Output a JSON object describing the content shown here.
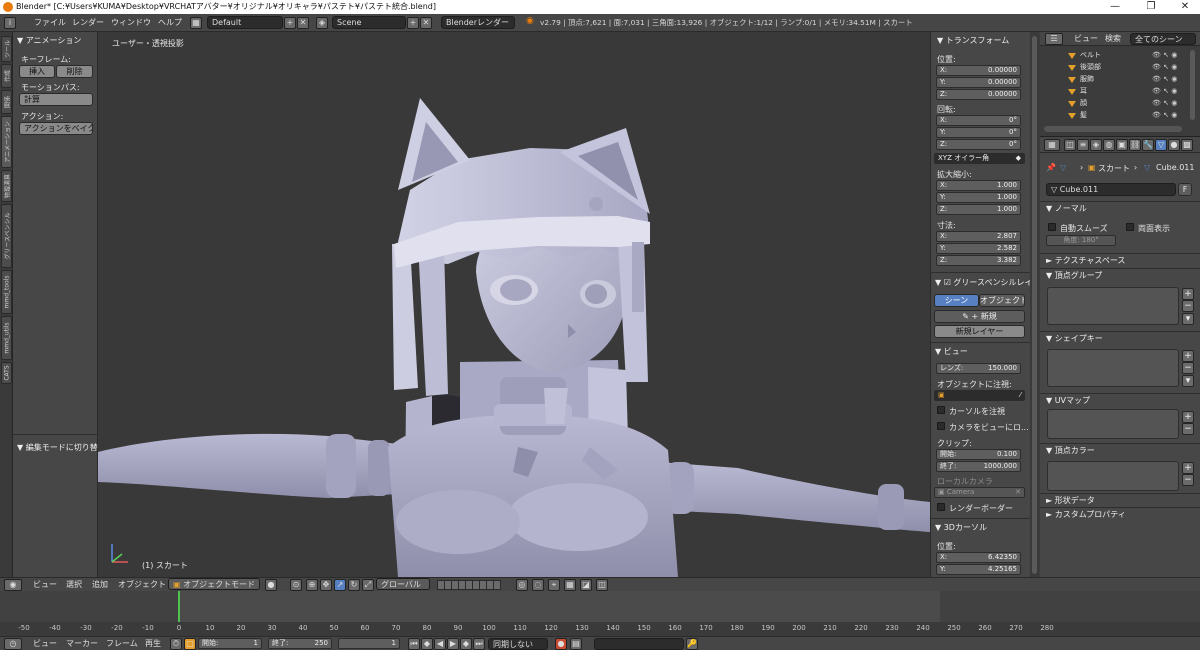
{
  "titlebar": {
    "text": "Blender* [C:¥Users¥KUMA¥Desktop¥VRCHATアバター¥オリジナル¥オリキャラ¥パステト¥パステト統合.blend]",
    "minimize": "—",
    "maximize": "❐",
    "close": "✕"
  },
  "topbar": {
    "menus": [
      "ファイル",
      "レンダー",
      "ウィンドウ",
      "ヘルプ"
    ],
    "screen_layout": "Default",
    "scene": "Scene",
    "render_engine": "Blenderレンダー",
    "stats": "v2.79 | 頂点:7,621 | 面:7,031 | 三角面:13,926 | オブジェクト:1/12 | ランプ:0/1 | メモリ:34.51M | スカート"
  },
  "tool_tabs": [
    "ツール",
    "作成",
    "関係",
    "アニメーション",
    "物理演算",
    "グリースペンシル",
    "mmd_tools",
    "mmd_utils",
    "CATS"
  ],
  "shelf": {
    "panel_title": "アニメーション",
    "keyframes_label": "キーフレーム:",
    "insert": "挿入",
    "delete": "削除",
    "motion_paths_label": "モーションパス:",
    "calculate": "計算",
    "action_label": "アクション:",
    "bake_action": "アクションをベイク",
    "operator_panel": "編集モードに切り替え"
  },
  "viewport": {
    "label": "ユーザー・透視投影",
    "object_label": "(1) スカート"
  },
  "npanel": {
    "transform_title": "トランスフォーム",
    "location_label": "位置:",
    "location": [
      {
        "axis": "X:",
        "value": "0.00000"
      },
      {
        "axis": "Y:",
        "value": "0.00000"
      },
      {
        "axis": "Z:",
        "value": "0.00000"
      }
    ],
    "rotation_label": "回転:",
    "rotation": [
      {
        "axis": "X:",
        "value": "0°"
      },
      {
        "axis": "Y:",
        "value": "0°"
      },
      {
        "axis": "Z:",
        "value": "0°"
      }
    ],
    "rotation_mode": "XYZ オイラー角",
    "scale_label": "拡大縮小:",
    "scale": [
      {
        "axis": "X:",
        "value": "1.000"
      },
      {
        "axis": "Y:",
        "value": "1.000"
      },
      {
        "axis": "Z:",
        "value": "1.000"
      }
    ],
    "dimensions_label": "寸法:",
    "dimensions": [
      {
        "axis": "X:",
        "value": "2.807"
      },
      {
        "axis": "Y:",
        "value": "2.582"
      },
      {
        "axis": "Z:",
        "value": "3.382"
      }
    ],
    "grease_title": "グリースペンシルレイ",
    "scene_btn": "シーン",
    "object_btn": "オブジェクト",
    "new_btn": "新規",
    "new_layer_btn": "新規レイヤー",
    "view_title": "ビュー",
    "lens_label": "レンズ:",
    "lens_value": "150.000",
    "lock_object_label": "オブジェクトに注視:",
    "lock_cursor": "カーソルを注視",
    "lock_camera": "カメラをビューにロ...",
    "clip_label": "クリップ:",
    "clip_start_label": "開始:",
    "clip_start": "0.100",
    "clip_end_label": "終了:",
    "clip_end": "1000.000",
    "local_camera_label": "ローカルカメラ",
    "camera": "Camera",
    "render_border": "レンダーボーダー",
    "cursor_title": "3Dカーソル",
    "cursor_location_label": "位置:",
    "cursor_x_label": "X:",
    "cursor_x": "6.42350",
    "cursor_y_label": "Y:",
    "cursor_y": "4.25165"
  },
  "outliner": {
    "view_menu": "ビュー",
    "search_menu": "検索",
    "scene_filter": "全てのシーン",
    "items": [
      "ベルト",
      "後頭部",
      "服飾",
      "耳",
      "顔",
      "髪"
    ]
  },
  "properties": {
    "breadcrumb_object": "スカート",
    "breadcrumb_data": "Cube.011",
    "mesh_name": "Cube.011",
    "fake_user": "F",
    "normals_title": "ノーマル",
    "auto_smooth": "自動スムーズ",
    "double_sided": "両面表示",
    "angle_label": "角度:",
    "angle_value": "180°",
    "texture_space": "テクスチャスペース",
    "vertex_groups": "頂点グループ",
    "shape_keys": "シェイプキー",
    "uv_maps": "UVマップ",
    "vertex_colors": "頂点カラー",
    "geometry_data": "形状データ",
    "custom_props": "カスタムプロパティ"
  },
  "viewport_header": {
    "menus": [
      "ビュー",
      "選択",
      "追加",
      "オブジェクト"
    ],
    "mode": "オブジェクトモード",
    "orientation": "グローバル"
  },
  "timeline": {
    "ticks": [
      "-50",
      "-40",
      "-30",
      "-20",
      "-10",
      "0",
      "10",
      "20",
      "30",
      "40",
      "50",
      "60",
      "70",
      "80",
      "90",
      "100",
      "110",
      "120",
      "130",
      "140",
      "150",
      "160",
      "170",
      "180",
      "190",
      "200",
      "210",
      "220",
      "230",
      "240",
      "250",
      "260",
      "270",
      "280"
    ],
    "menus": [
      "ビュー",
      "マーカー",
      "フレーム",
      "再生"
    ],
    "start_label": "開始:",
    "start": "1",
    "end_label": "終了:",
    "end": "250",
    "current": "1",
    "sync": "同期しない"
  },
  "colors": {
    "active_blue": "#5680c2",
    "object_orange": "#e39e2c",
    "current_frame_green": "#4fc34f"
  }
}
